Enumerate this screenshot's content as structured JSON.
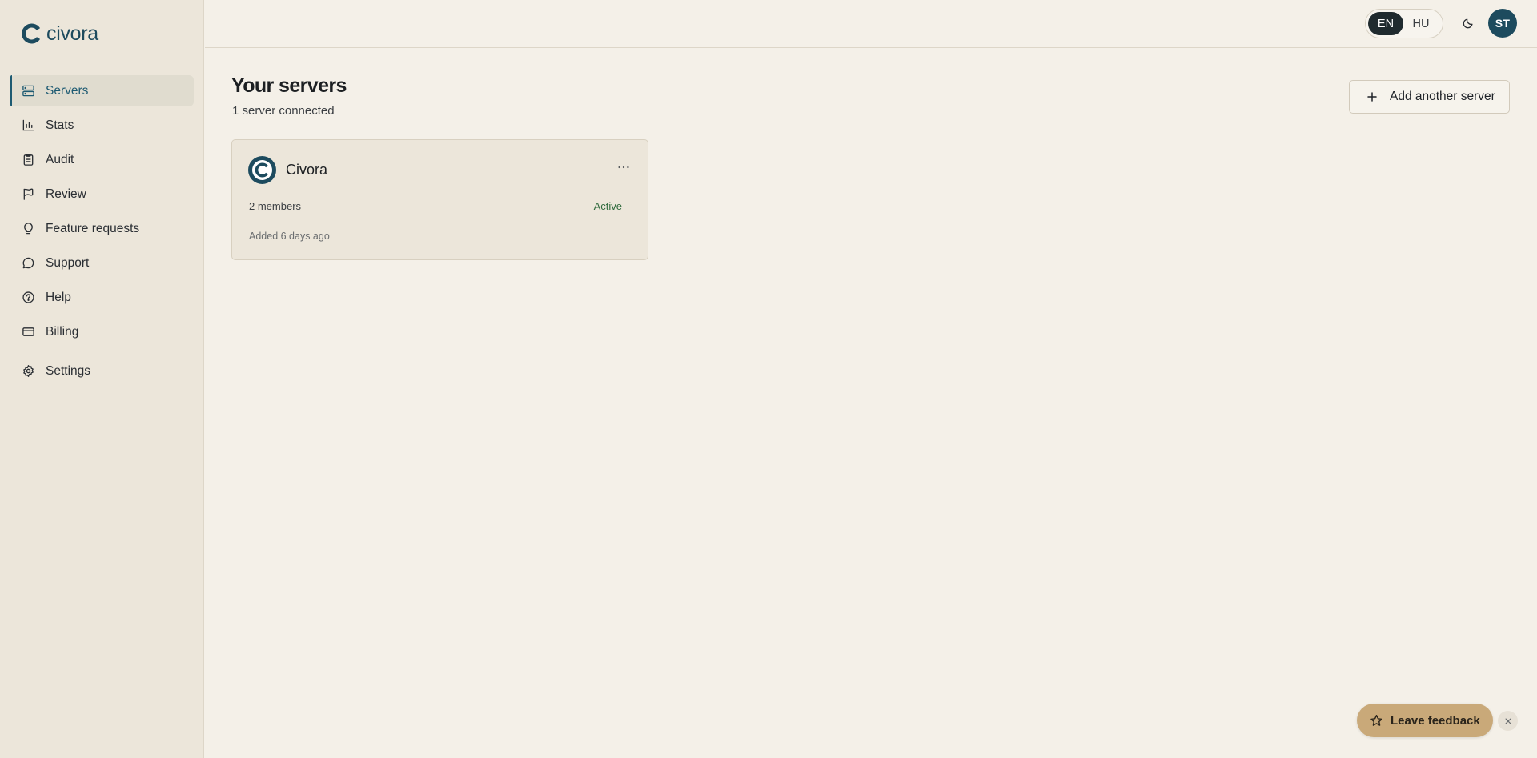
{
  "brand": {
    "name": "civora",
    "accent": "#1d4b5e"
  },
  "sidebar": {
    "items": [
      {
        "label": "Servers",
        "icon": "server-icon",
        "active": true
      },
      {
        "label": "Stats",
        "icon": "bar-chart-icon"
      },
      {
        "label": "Audit",
        "icon": "clipboard-icon"
      },
      {
        "label": "Review",
        "icon": "flag-icon"
      },
      {
        "label": "Feature requests",
        "icon": "lightbulb-icon"
      },
      {
        "label": "Support",
        "icon": "chat-bubble-icon"
      },
      {
        "label": "Help",
        "icon": "help-circle-icon"
      },
      {
        "label": "Billing",
        "icon": "credit-card-icon"
      }
    ],
    "settings": {
      "label": "Settings",
      "icon": "gear-icon"
    }
  },
  "topbar": {
    "languages": [
      "EN",
      "HU"
    ],
    "selected_language": "EN",
    "theme_icon": "moon-icon",
    "avatar_initials": "ST"
  },
  "main": {
    "title": "Your servers",
    "subtitle": "1 server connected",
    "add_button_label": "Add another server"
  },
  "servers": [
    {
      "name": "Civora",
      "members": "2 members",
      "status": "Active",
      "added": "Added 6 days ago"
    }
  ],
  "feedback": {
    "label": "Leave feedback",
    "icon": "star-icon",
    "close_icon": "close-icon"
  }
}
